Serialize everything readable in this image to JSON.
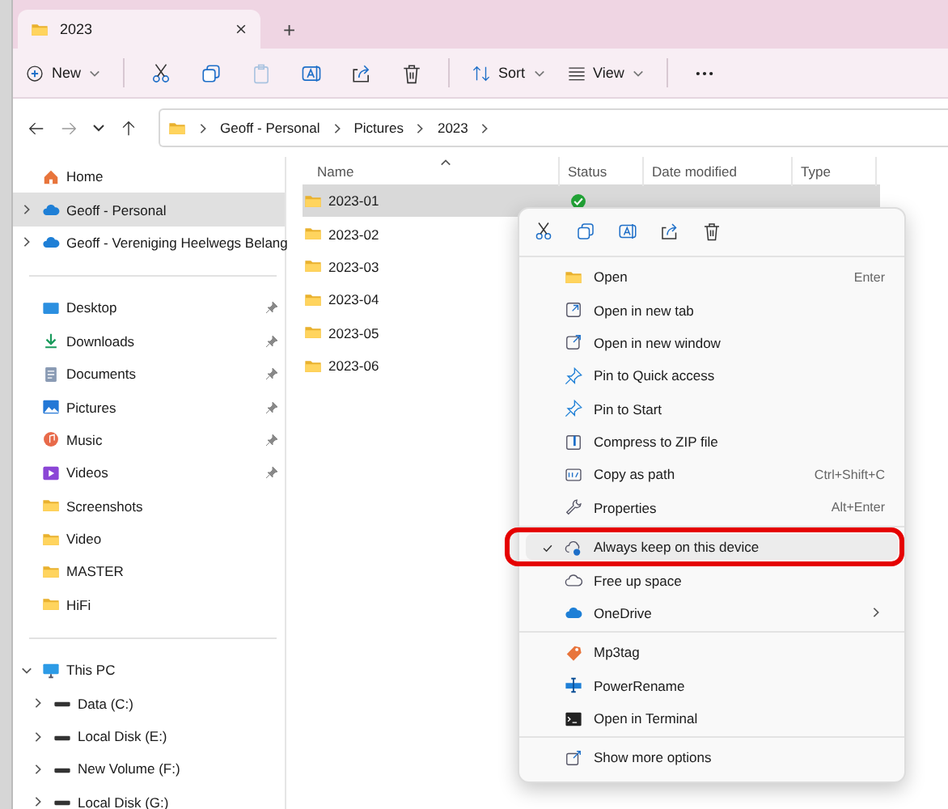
{
  "window": {
    "tabs": [
      {
        "label": "2023",
        "selected": true
      }
    ],
    "new_tab": "+"
  },
  "toolbar": {
    "new": "New",
    "sort": "Sort",
    "view": "View"
  },
  "address": {
    "breadcrumbs": [
      "Geoff - Personal",
      "Pictures",
      "2023"
    ]
  },
  "sidebar": {
    "groups": [
      [
        {
          "label": "Home",
          "selected": false
        },
        {
          "label": "Geoff - Personal",
          "selected": true,
          "expanded": false
        },
        {
          "label": "Geoff - Vereniging Heelwegs Belang",
          "selected": false,
          "expanded": false
        }
      ],
      [
        {
          "label": "Desktop",
          "selected": false,
          "pinned": true
        },
        {
          "label": "Downloads",
          "selected": false,
          "pinned": true
        },
        {
          "label": "Documents",
          "selected": false,
          "pinned": true
        },
        {
          "label": "Pictures",
          "selected": false,
          "pinned": true
        },
        {
          "label": "Music",
          "selected": false,
          "pinned": true
        },
        {
          "label": "Videos",
          "selected": false,
          "pinned": true
        },
        {
          "label": "Screenshots",
          "selected": false,
          "pinned": false
        },
        {
          "label": "Video",
          "selected": false,
          "pinned": false
        },
        {
          "label": "MASTER",
          "selected": false,
          "pinned": false
        },
        {
          "label": "HiFi",
          "selected": false,
          "pinned": false
        }
      ],
      [
        {
          "label": "This PC",
          "selected": false,
          "expanded": true,
          "children": [
            {
              "label": "Data (C:)",
              "selected": false,
              "expanded": false
            },
            {
              "label": "Local Disk (E:)",
              "selected": false,
              "expanded": false
            },
            {
              "label": "New Volume (F:)",
              "selected": false,
              "expanded": false
            },
            {
              "label": "Local Disk (G:)",
              "selected": false,
              "expanded": false
            }
          ]
        }
      ]
    ]
  },
  "table": {
    "columns": [
      "Name",
      "Status",
      "Date modified",
      "Type"
    ],
    "rows": [
      {
        "name": "2023-01",
        "selected": true,
        "synced": true
      },
      {
        "name": "2023-02",
        "selected": false
      },
      {
        "name": "2023-03",
        "selected": false
      },
      {
        "name": "2023-04",
        "selected": false
      },
      {
        "name": "2023-05",
        "selected": false
      },
      {
        "name": "2023-06",
        "selected": false
      }
    ]
  },
  "context_menu": {
    "groups": [
      [
        {
          "label": "Open",
          "shortcut": "Enter",
          "selected": false
        },
        {
          "label": "Open in new tab",
          "selected": false
        },
        {
          "label": "Open in new window",
          "selected": false
        },
        {
          "label": "Pin to Quick access",
          "selected": false
        },
        {
          "label": "Pin to Start",
          "selected": false
        },
        {
          "label": "Compress to ZIP file",
          "selected": false
        },
        {
          "label": "Copy as path",
          "shortcut": "Ctrl+Shift+C",
          "selected": false
        },
        {
          "label": "Properties",
          "shortcut": "Alt+Enter",
          "selected": false
        }
      ],
      [
        {
          "label": "Always keep on this device",
          "checked": true,
          "selected": true,
          "annotated": true
        },
        {
          "label": "Free up space",
          "selected": false
        },
        {
          "label": "OneDrive",
          "selected": false,
          "submenu": true
        }
      ],
      [
        {
          "label": "Mp3tag",
          "selected": false
        },
        {
          "label": "PowerRename",
          "selected": false
        },
        {
          "label": "Open in Terminal",
          "selected": false
        }
      ],
      [
        {
          "label": "Show more options",
          "selected": false
        }
      ]
    ]
  }
}
